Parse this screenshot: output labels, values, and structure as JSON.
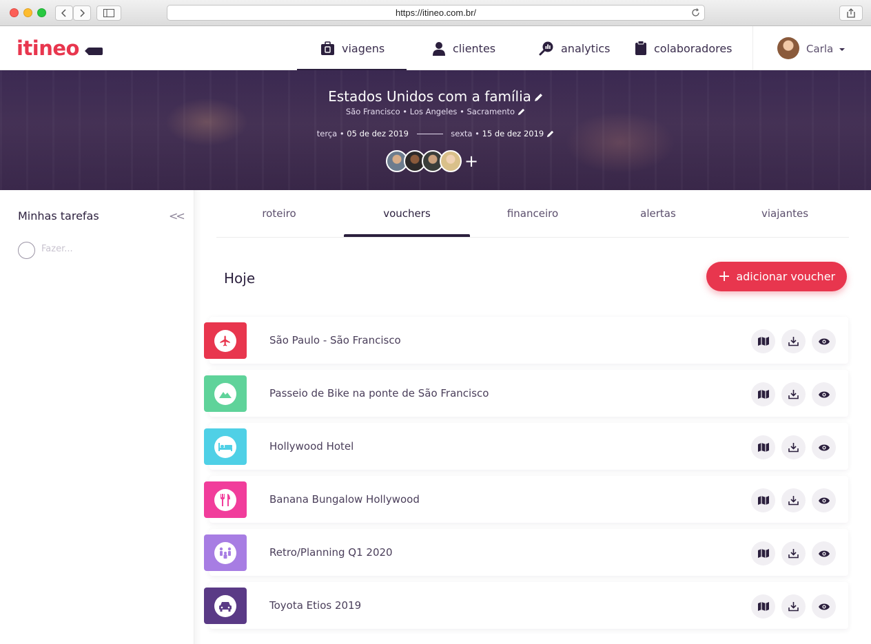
{
  "browser": {
    "url": "https://itineo.com.br/"
  },
  "header": {
    "logo": "itineo",
    "nav": [
      {
        "label": "viagens",
        "icon": "luggage-icon",
        "active": true
      },
      {
        "label": "clientes",
        "icon": "person-icon",
        "active": false
      },
      {
        "label": "analytics",
        "icon": "analytics-magnifier-icon",
        "active": false
      },
      {
        "label": "colaboradores",
        "icon": "clipboard-icon",
        "active": false
      }
    ],
    "user": {
      "name": "Carla"
    }
  },
  "trip": {
    "title": "Estados Unidos com a família",
    "cities": "São Francisco • Los Angeles • Sacramento",
    "start_day": "terça •",
    "start_date": "05 de dez 2019",
    "end_day": "sexta •",
    "end_date": "15 de dez 2019",
    "add_traveler": "+"
  },
  "sidebar": {
    "title": "Minhas tarefas",
    "collapse": "<<",
    "todo_placeholder": "Fazer..."
  },
  "tabs": [
    {
      "label": "roteiro",
      "active": false
    },
    {
      "label": "vouchers",
      "active": true
    },
    {
      "label": "financeiro",
      "active": false
    },
    {
      "label": "alertas",
      "active": false
    },
    {
      "label": "viajantes",
      "active": false
    }
  ],
  "section": {
    "title": "Hoje",
    "add_button": "adicionar voucher",
    "add_button_plus": "+"
  },
  "colors": {
    "brand_red": "#e8364e",
    "dark_purple": "#2b1f3d",
    "flight": "#e8364e",
    "activity": "#5fd39a",
    "hotel": "#4fd0e6",
    "restaurant": "#f13d9b",
    "event": "#a77de3",
    "car": "#5a3a86"
  },
  "vouchers": [
    {
      "title": "São Paulo - São Francisco",
      "icon": "airplane-icon",
      "color": "#e8364e"
    },
    {
      "title": "Passeio de Bike na ponte de São Francisco",
      "icon": "mountain-icon",
      "color": "#5fd39a"
    },
    {
      "title": "Hollywood Hotel",
      "icon": "bed-icon",
      "color": "#4fd0e6"
    },
    {
      "title": "Banana Bungalow Hollywood",
      "icon": "cutlery-icon",
      "color": "#f13d9b"
    },
    {
      "title": "Retro/Planning Q1 2020",
      "icon": "people-meeting-icon",
      "color": "#a77de3"
    },
    {
      "title": "Toyota Etios 2019",
      "icon": "car-icon",
      "color": "#5a3a86"
    }
  ]
}
